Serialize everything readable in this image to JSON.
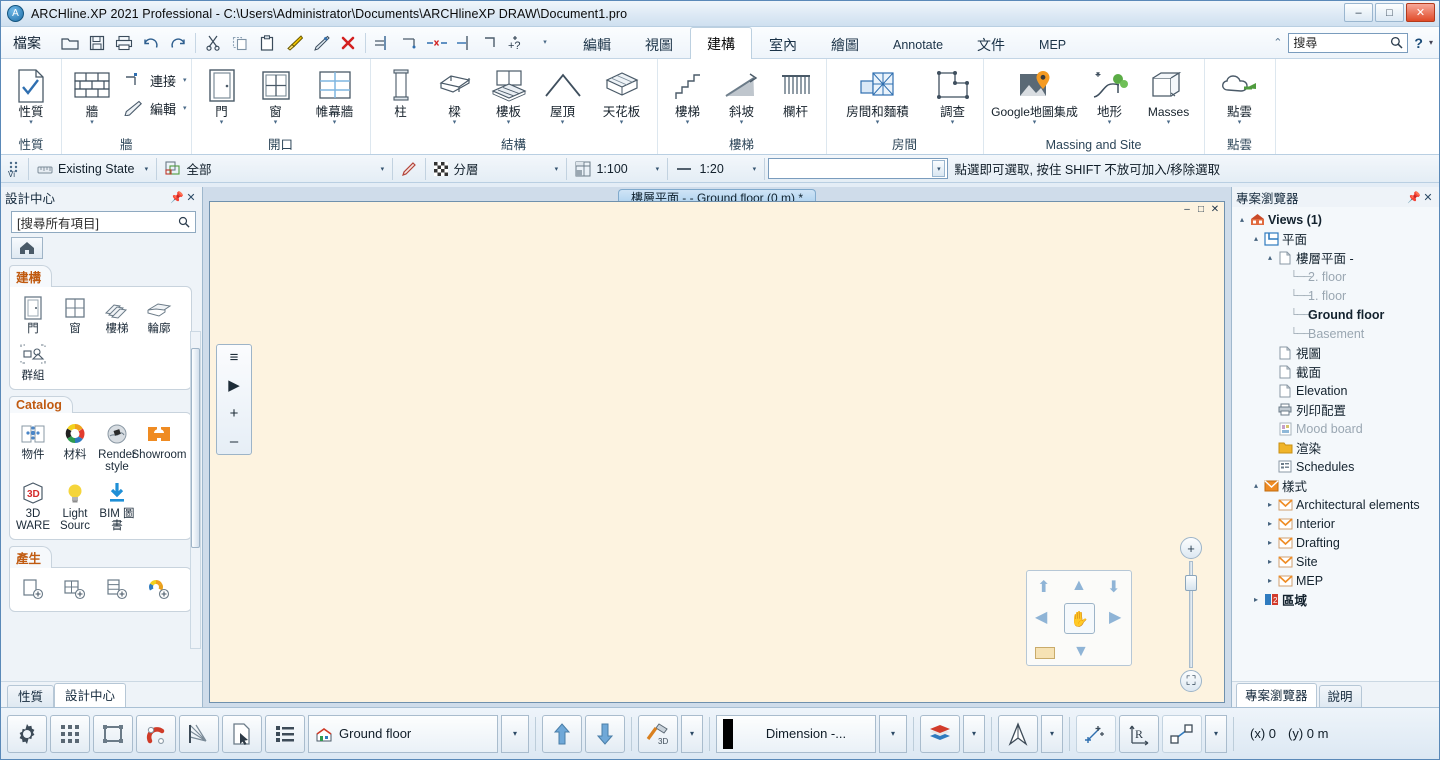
{
  "window": {
    "title": "ARCHline.XP 2021  Professional - C:\\Users\\Administrator\\Documents\\ARCHlineXP DRAW\\Document1.pro",
    "app_icon": "archline-logo-icon",
    "minimize": "–",
    "maximize": "□",
    "close": "✕"
  },
  "menu": {
    "file_label": "檔案",
    "quick_access": [
      {
        "name": "open-icon",
        "glyph": "open"
      },
      {
        "name": "save-icon",
        "glyph": "save"
      },
      {
        "name": "print-icon",
        "glyph": "print"
      },
      {
        "name": "undo-icon",
        "glyph": "undo"
      },
      {
        "name": "redo-icon",
        "glyph": "redo"
      },
      {
        "name": "cut-icon",
        "glyph": "cut"
      },
      {
        "name": "copy-icon",
        "glyph": "copy"
      },
      {
        "name": "paste-icon",
        "glyph": "paste"
      },
      {
        "name": "paintbrush-icon",
        "glyph": "brush"
      },
      {
        "name": "pen-icon",
        "glyph": "pen"
      },
      {
        "name": "delete-icon",
        "glyph": "delete"
      },
      {
        "name": "trim-icon",
        "glyph": "trim"
      },
      {
        "name": "extend-icon",
        "glyph": "extend"
      },
      {
        "name": "break-icon",
        "glyph": "break"
      },
      {
        "name": "divide-icon",
        "glyph": "divide"
      },
      {
        "name": "corner-icon",
        "glyph": "corner"
      },
      {
        "name": "help-plus-icon",
        "glyph": "helpplus"
      }
    ]
  },
  "ribbon": {
    "tabs": [
      {
        "label": "編輯",
        "active": false,
        "latin": false
      },
      {
        "label": "視圖",
        "active": false,
        "latin": false
      },
      {
        "label": "建構",
        "active": true,
        "latin": false
      },
      {
        "label": "室內",
        "active": false,
        "latin": false
      },
      {
        "label": "繪圖",
        "active": false,
        "latin": false
      },
      {
        "label": "Annotate",
        "active": false,
        "latin": true
      },
      {
        "label": "文件",
        "active": false,
        "latin": false
      },
      {
        "label": "MEP",
        "active": false,
        "latin": true
      }
    ],
    "search": {
      "placeholder": "搜尋",
      "icon": "search-icon"
    },
    "help_label": "?",
    "collapse_icon": "chevron-up-icon",
    "groups": [
      {
        "title": "性質",
        "big": [
          {
            "label": "性質",
            "icon": "properties-icon",
            "caret": true
          }
        ]
      },
      {
        "title": "牆",
        "big": [
          {
            "label": "牆",
            "icon": "wall-icon",
            "caret": true
          }
        ],
        "small": [
          {
            "label": "連接",
            "icon": "wall-connect-icon",
            "caret": true
          },
          {
            "label": "編輯",
            "icon": "wall-edit-pencil-icon",
            "caret": true
          }
        ]
      },
      {
        "title": "開口",
        "big": [
          {
            "label": "門",
            "icon": "door-icon",
            "caret": true
          },
          {
            "label": "窗",
            "icon": "window-icon",
            "caret": true
          },
          {
            "label": "帷幕牆",
            "icon": "curtain-wall-icon",
            "caret": true
          }
        ]
      },
      {
        "title": "結構",
        "big": [
          {
            "label": "柱",
            "icon": "column-icon",
            "caret": false
          },
          {
            "label": "樑",
            "icon": "beam-icon",
            "caret": true
          },
          {
            "label": "樓板",
            "icon": "slab-icon",
            "caret": true
          },
          {
            "label": "屋頂",
            "icon": "roof-icon",
            "caret": true
          },
          {
            "label": "天花板",
            "icon": "ceiling-icon",
            "caret": true
          }
        ]
      },
      {
        "title": "樓梯",
        "big": [
          {
            "label": "樓梯",
            "icon": "stair-icon",
            "caret": true
          },
          {
            "label": "斜坡",
            "icon": "ramp-icon",
            "caret": true
          },
          {
            "label": "欄杆",
            "icon": "railing-icon",
            "caret": false
          }
        ]
      },
      {
        "title": "房間",
        "big": [
          {
            "label": "房間和麵積",
            "icon": "room-area-icon",
            "caret": true
          },
          {
            "label": "調查",
            "icon": "survey-icon",
            "caret": true
          }
        ]
      },
      {
        "title": "Massing and Site",
        "big": [
          {
            "label": "Google地圖集成",
            "icon": "google-maps-icon",
            "caret": true
          },
          {
            "label": "地形",
            "icon": "terrain-icon",
            "caret": true
          },
          {
            "label": "Masses",
            "icon": "masses-icon",
            "caret": true
          }
        ]
      },
      {
        "title": "點雲",
        "big": [
          {
            "label": "點雲",
            "icon": "point-cloud-icon",
            "caret": true
          }
        ]
      }
    ]
  },
  "options_bar": {
    "handle_icon": "drag-handle-icon",
    "state": {
      "icon": "measure-icon",
      "label": "Existing State"
    },
    "scope": {
      "icon": "layers-all-icon",
      "label": "全部"
    },
    "link_icon": "link-pen-icon",
    "layer": {
      "icon": "checker-icon",
      "label": "分層"
    },
    "scale_plan": {
      "icon": "scale-icon",
      "label": "1:100"
    },
    "scale_detail": {
      "icon": "line-icon",
      "label": "1:20"
    },
    "empty_combo_value": "",
    "status_text": "點選即可選取, 按住 SHIFT 不放可加入/移除選取"
  },
  "left_panel": {
    "title": "設計中心",
    "pin_icon": "pin-icon",
    "close_icon": "close-icon",
    "search_placeholder": "[搜尋所有項目]",
    "search_icon": "search-icon",
    "home_icon": "home-icon",
    "sections": [
      {
        "title": "建構",
        "items": [
          {
            "label": "門",
            "icon": "door-icon"
          },
          {
            "label": "窗",
            "icon": "window-icon"
          },
          {
            "label": "樓梯",
            "icon": "stair-icon"
          },
          {
            "label": "輪廓",
            "icon": "profile-icon"
          },
          {
            "label": "群組",
            "icon": "group-icon"
          }
        ]
      },
      {
        "title": "Catalog",
        "items": [
          {
            "label": "物件",
            "icon": "object-icon"
          },
          {
            "label": "材料",
            "icon": "material-icon"
          },
          {
            "label": "Render style",
            "icon": "render-style-icon"
          },
          {
            "label": "Showroom",
            "icon": "showroom-icon"
          },
          {
            "label": "3D WARE",
            "icon": "3d-warehouse-icon"
          },
          {
            "label": "Light Sourc",
            "icon": "light-source-icon"
          },
          {
            "label": "BIM 圖書",
            "icon": "bim-library-icon"
          }
        ]
      },
      {
        "title": "產生",
        "items": [
          {
            "label": "",
            "icon": "new-door-icon"
          },
          {
            "label": "",
            "icon": "new-window-icon"
          },
          {
            "label": "",
            "icon": "new-object-icon"
          },
          {
            "label": "",
            "icon": "new-material-icon"
          }
        ]
      }
    ],
    "tabs": [
      {
        "label": "性質",
        "active": false
      },
      {
        "label": "設計中心",
        "active": true
      }
    ]
  },
  "canvas": {
    "document_tab": "樓層平面 -  - Ground floor (0 m) *",
    "window_buttons": [
      "–",
      "□",
      "✕"
    ],
    "tools": [
      {
        "name": "list-tool-icon",
        "glyph": "≡"
      },
      {
        "name": "play-tool-icon",
        "glyph": "▶"
      },
      {
        "name": "add-tool-icon",
        "glyph": "+"
      },
      {
        "name": "minus-tool-icon",
        "glyph": "–"
      }
    ],
    "nav": {
      "up_icon": "arrow-up-icon",
      "down_icon": "arrow-down-icon",
      "left_icon": "arrow-left-icon",
      "right_icon": "arrow-right-icon",
      "pan_icon": "pan-hand-icon",
      "zoom_in_icon": "zoom-in-icon",
      "zoom_out_icon": "zoom-out-icon",
      "fit_icon": "zoom-fit-icon"
    }
  },
  "right_panel": {
    "title": "專案瀏覽器",
    "pin_icon": "pin-icon",
    "close_icon": "close-icon",
    "tree": [
      {
        "label": "Views (1)",
        "depth": 0,
        "expander": "▴",
        "icon": "views-house-icon",
        "bold": true,
        "dim": false,
        "dash": false
      },
      {
        "label": "平面",
        "depth": 1,
        "expander": "▴",
        "icon": "plan-icon",
        "bold": false,
        "dim": false,
        "dash": false
      },
      {
        "label": "樓層平面 -",
        "depth": 2,
        "expander": "▴",
        "icon": "page-icon",
        "bold": false,
        "dim": false,
        "dash": false
      },
      {
        "label": "2. floor",
        "depth": 3,
        "expander": "",
        "icon": "",
        "bold": false,
        "dim": true,
        "dash": true
      },
      {
        "label": "1. floor",
        "depth": 3,
        "expander": "",
        "icon": "",
        "bold": false,
        "dim": true,
        "dash": true
      },
      {
        "label": "Ground floor",
        "depth": 3,
        "expander": "",
        "icon": "",
        "bold": true,
        "dim": false,
        "dash": true
      },
      {
        "label": "Basement",
        "depth": 3,
        "expander": "",
        "icon": "",
        "bold": false,
        "dim": true,
        "dash": true
      },
      {
        "label": "視圖",
        "depth": 2,
        "expander": "",
        "icon": "page-icon",
        "bold": false,
        "dim": false,
        "dash": false
      },
      {
        "label": "截面",
        "depth": 2,
        "expander": "",
        "icon": "page-icon",
        "bold": false,
        "dim": false,
        "dash": false
      },
      {
        "label": "Elevation",
        "depth": 2,
        "expander": "",
        "icon": "page-icon",
        "bold": false,
        "dim": false,
        "dash": false
      },
      {
        "label": "列印配置",
        "depth": 2,
        "expander": "",
        "icon": "printer-icon",
        "bold": false,
        "dim": false,
        "dash": false
      },
      {
        "label": "Mood board",
        "depth": 2,
        "expander": "",
        "icon": "moodboard-icon",
        "bold": false,
        "dim": true,
        "dash": false
      },
      {
        "label": "渲染",
        "depth": 2,
        "expander": "",
        "icon": "folder-icon",
        "bold": false,
        "dim": false,
        "dash": false
      },
      {
        "label": "Schedules",
        "depth": 2,
        "expander": "",
        "icon": "schedule-icon",
        "bold": false,
        "dim": false,
        "dash": false
      },
      {
        "label": "樣式",
        "depth": 1,
        "expander": "▴",
        "icon": "styles-icon",
        "bold": false,
        "dim": false,
        "dash": false
      },
      {
        "label": "Architectural elements",
        "depth": 2,
        "expander": "▸",
        "icon": "styles-sub-icon",
        "bold": false,
        "dim": false,
        "dash": false
      },
      {
        "label": "Interior",
        "depth": 2,
        "expander": "▸",
        "icon": "styles-sub-icon",
        "bold": false,
        "dim": false,
        "dash": false
      },
      {
        "label": "Drafting",
        "depth": 2,
        "expander": "▸",
        "icon": "styles-sub-icon",
        "bold": false,
        "dim": false,
        "dash": false
      },
      {
        "label": "Site",
        "depth": 2,
        "expander": "▸",
        "icon": "styles-sub-icon",
        "bold": false,
        "dim": false,
        "dash": false
      },
      {
        "label": "MEP",
        "depth": 2,
        "expander": "▸",
        "icon": "styles-sub-icon",
        "bold": false,
        "dim": false,
        "dash": false
      },
      {
        "label": "區域",
        "depth": 1,
        "expander": "▸",
        "icon": "zone-icon",
        "bold": true,
        "dim": false,
        "dash": false
      }
    ],
    "tabs": [
      {
        "label": "專案瀏覽器",
        "active": true
      },
      {
        "label": "說明",
        "active": false
      }
    ]
  },
  "bottom_bar": {
    "buttons": [
      {
        "name": "settings-gear-button",
        "icon": "gear-icon"
      },
      {
        "name": "grid-button",
        "icon": "grid-icon"
      },
      {
        "name": "bounding-box-button",
        "icon": "bounding-box-icon"
      },
      {
        "name": "snap-magnet-button",
        "icon": "magnet-icon"
      },
      {
        "name": "angle-snap-button",
        "icon": "angle-rays-icon"
      },
      {
        "name": "select-page-button",
        "icon": "page-cursor-icon"
      },
      {
        "name": "list-button",
        "icon": "list-icon"
      }
    ],
    "floor_combo": {
      "icon": "floor-house-icon",
      "value": "Ground floor",
      "caret": "▾"
    },
    "floor_up": {
      "name": "floor-up-button",
      "icon": "arrow-up-icon"
    },
    "floor_down": {
      "name": "floor-down-button",
      "icon": "arrow-down-icon"
    },
    "build3d": {
      "name": "build-3d-button",
      "icon": "hammer-3d-icon",
      "caret": "▾"
    },
    "dimension_combo": {
      "swatch": "#000000",
      "value": "Dimension -...",
      "caret": "▾"
    },
    "layers": {
      "name": "layers-button",
      "icon": "layers-stack-icon",
      "caret": "▾"
    },
    "north": {
      "name": "north-arrow-button",
      "icon": "north-arrow-icon",
      "caret": "▾"
    },
    "snap_point": {
      "name": "snap-point-button",
      "icon": "snap-point-icon"
    },
    "relative_coord": {
      "name": "relative-coordinate-button",
      "icon": "r-axis-icon"
    },
    "polyline": {
      "name": "polyline-button",
      "icon": "polyline-icon",
      "caret": "▾"
    },
    "coordinates": {
      "x_label": "(x) 0",
      "y_label": "(y) 0 m"
    }
  }
}
